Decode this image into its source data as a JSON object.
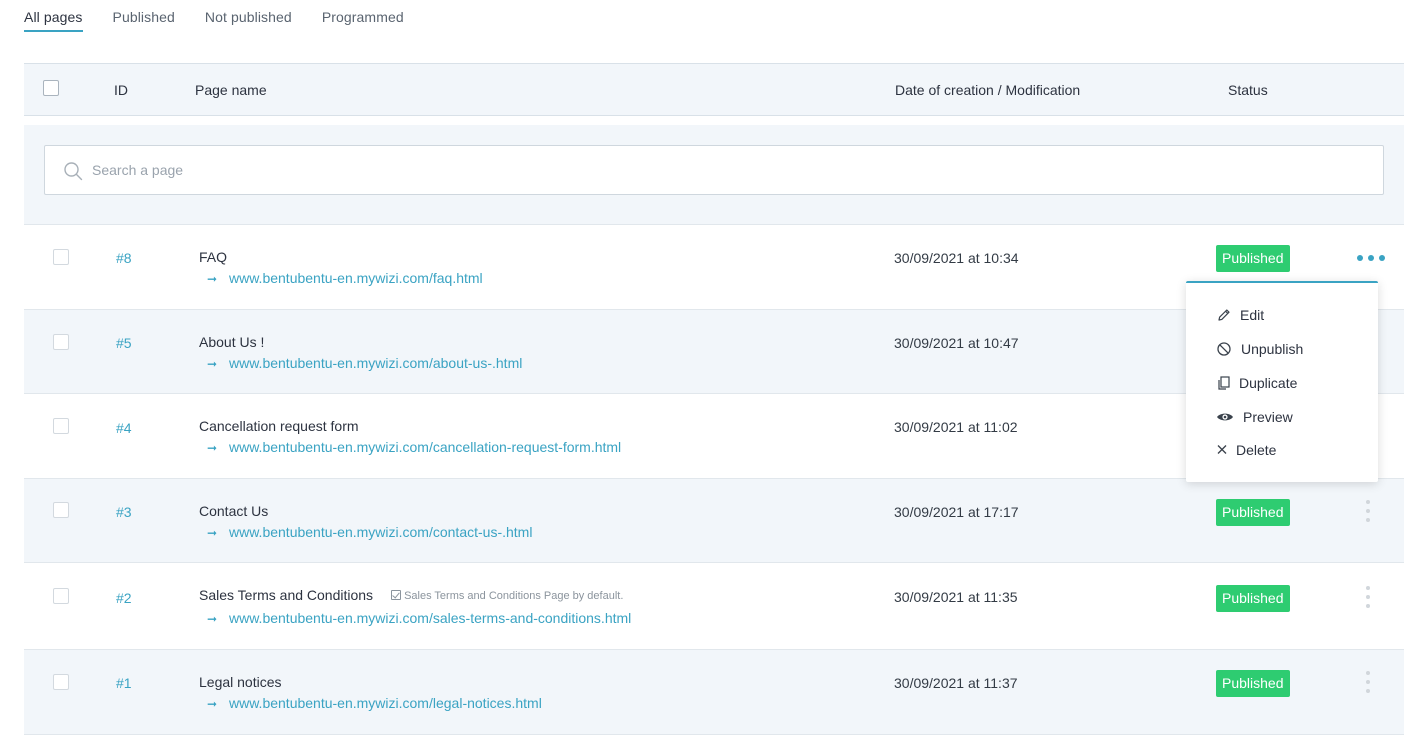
{
  "tabs": [
    {
      "label": "All pages",
      "active": true
    },
    {
      "label": "Published",
      "active": false
    },
    {
      "label": "Not published",
      "active": false
    },
    {
      "label": "Programmed",
      "active": false
    }
  ],
  "table": {
    "headers": {
      "id": "ID",
      "name": "Page name",
      "date": "Date of creation / Modification",
      "status": "Status"
    },
    "search_placeholder": "Search a page",
    "rows": [
      {
        "id": "#8",
        "name": "FAQ",
        "url": "www.bentubentu-en.mywizi.com/faq.html",
        "date": "30/09/2021 at 10:34",
        "status": "Published",
        "note": ""
      },
      {
        "id": "#5",
        "name": "About Us !",
        "url": "www.bentubentu-en.mywizi.com/about-us-.html",
        "date": "30/09/2021 at 10:47",
        "status": "",
        "note": ""
      },
      {
        "id": "#4",
        "name": "Cancellation request form",
        "url": "www.bentubentu-en.mywizi.com/cancellation-request-form.html",
        "date": "30/09/2021 at 11:02",
        "status": "",
        "note": ""
      },
      {
        "id": "#3",
        "name": "Contact Us",
        "url": "www.bentubentu-en.mywizi.com/contact-us-.html",
        "date": "30/09/2021 at 17:17",
        "status": "Published",
        "note": ""
      },
      {
        "id": "#2",
        "name": "Sales Terms and Conditions",
        "url": "www.bentubentu-en.mywizi.com/sales-terms-and-conditions.html",
        "date": "30/09/2021 at 11:35",
        "status": "Published",
        "note": "Sales Terms and Conditions Page by default."
      },
      {
        "id": "#1",
        "name": "Legal notices",
        "url": "www.bentubentu-en.mywizi.com/legal-notices.html",
        "date": "30/09/2021 at 11:37",
        "status": "Published",
        "note": ""
      }
    ]
  },
  "menu": {
    "items": [
      {
        "label": "Edit",
        "icon": "pencil-icon"
      },
      {
        "label": "Unpublish",
        "icon": "ban-icon"
      },
      {
        "label": "Duplicate",
        "icon": "copy-icon"
      },
      {
        "label": "Preview",
        "icon": "eye-icon"
      },
      {
        "label": "Delete",
        "icon": "close-icon"
      }
    ]
  },
  "colors": {
    "accent": "#3aa3c3",
    "published": "#2ecc71",
    "row_alt": "#f2f6fa"
  }
}
